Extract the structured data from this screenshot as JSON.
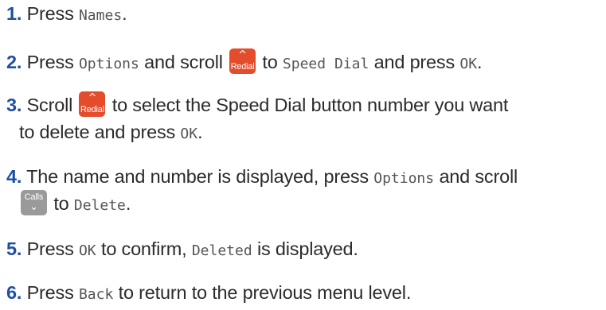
{
  "steps": [
    {
      "num": "1",
      "parts": [
        "Press ",
        "Names",
        "."
      ]
    },
    {
      "num": "2",
      "parts": [
        "Press ",
        "Options",
        " and scroll ",
        " to ",
        "Speed Dial",
        " and press ",
        "OK",
        "."
      ]
    },
    {
      "num": "3",
      "line1": [
        "Scroll ",
        " to select the Speed Dial button number you want"
      ],
      "line2": [
        "to delete and press ",
        "OK",
        "."
      ]
    },
    {
      "num": "4",
      "line1": [
        "The name and number is displayed, press ",
        "Options",
        " and scroll"
      ],
      "line2": [
        " to ",
        "Delete",
        "."
      ]
    },
    {
      "num": "5",
      "parts": [
        "Press ",
        "OK",
        " to confirm, ",
        "Deleted",
        " is displayed."
      ]
    },
    {
      "num": "6",
      "parts": [
        "Press ",
        "Back",
        " to return to the previous menu level."
      ]
    }
  ],
  "keys": {
    "redial": {
      "label": "Redial",
      "arrow": "^",
      "color": "#e44d2b"
    },
    "calls": {
      "label": "Calls",
      "arrow": "⌄",
      "color": "#9a9a9a"
    }
  },
  "colors": {
    "step_number": "#1f4fa1",
    "text": "#2b2b2b",
    "lcd_text": "#555555"
  }
}
